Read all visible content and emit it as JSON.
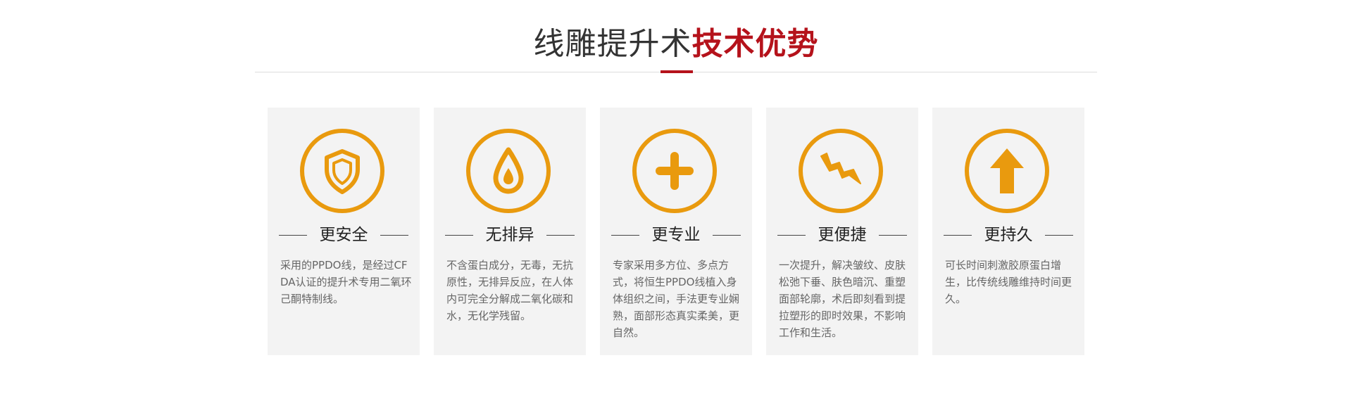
{
  "colors": {
    "accent": "#e99a0e",
    "brand_red": "#b5121b",
    "card_bg": "#f3f3f3",
    "title_text": "#333333",
    "body_text": "#666666"
  },
  "header": {
    "title_plain": "线雕提升术",
    "title_highlight": "技术优势"
  },
  "cards": [
    {
      "icon": "shield-icon",
      "title": "更安全",
      "description": "采用的PPDO线，是经过CFDA认证的提升术专用二氧环己酮特制线。"
    },
    {
      "icon": "drop-icon",
      "title": "无排异",
      "description": "不含蛋白成分，无毒，无抗原性，无排异反应，在人体内可完全分解成二氧化碳和水，无化学残留。"
    },
    {
      "icon": "plus-icon",
      "title": "更专业",
      "description": "专家采用多方位、多点方式，将恒生PPDO线植入身体组织之间，手法更专业娴熟，面部形态真实柔美，更自然。"
    },
    {
      "icon": "lightning-icon",
      "title": "更便捷",
      "description": "一次提升，解决皱纹、皮肤松弛下垂、肤色暗沉、重塑面部轮廓，术后即刻看到提拉塑形的即时效果，不影响工作和生活。"
    },
    {
      "icon": "arrow-up-icon",
      "title": "更持久",
      "description": "可长时间刺激胶原蛋白增生，比传统线雕维持时间更久。"
    }
  ]
}
